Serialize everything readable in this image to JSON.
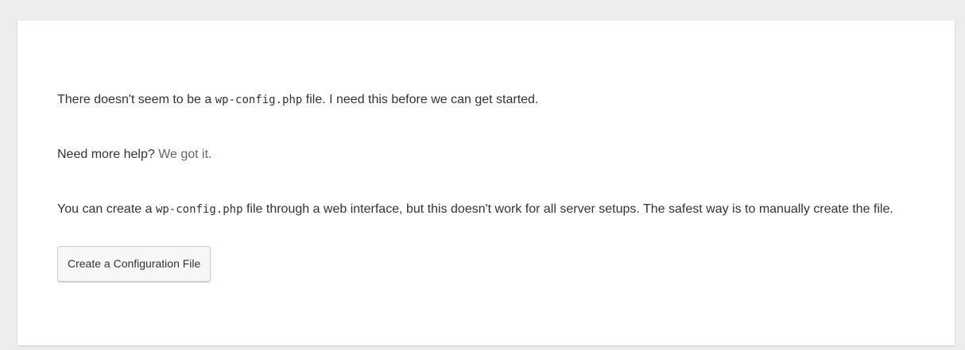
{
  "intro": {
    "text_before": "There doesn't seem to be a ",
    "filename": "wp-config.php",
    "text_after": " file. I need this before we can get started."
  },
  "help": {
    "prompt": "Need more help?",
    "link_label": "We got it."
  },
  "instructions": {
    "text_before": "You can create a ",
    "filename": "wp-config.php",
    "text_after": " file through a web interface, but this doesn't work for all server setups. The safest way is to manually create the file."
  },
  "actions": {
    "create_button_label": "Create a Configuration File"
  }
}
